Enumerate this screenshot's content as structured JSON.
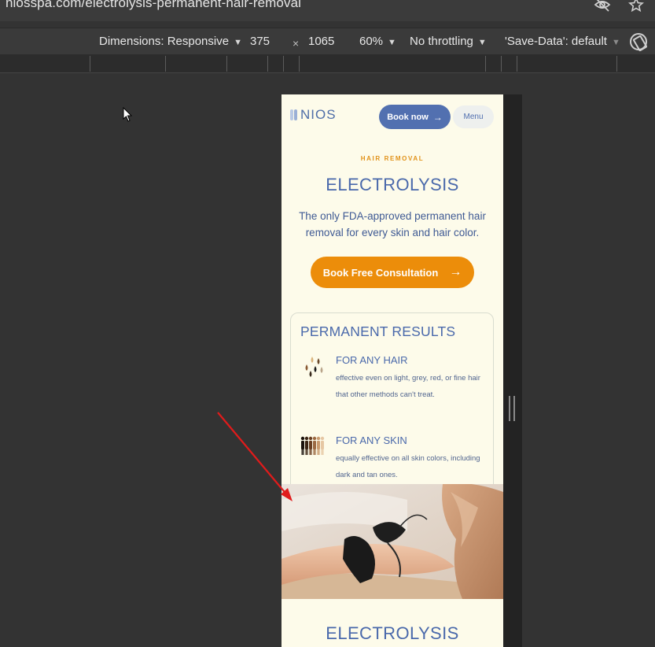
{
  "browser": {
    "url": "niosspa.com/electrolysis-permanent-hair-removal",
    "icons": [
      "eye-slash-icon",
      "star-icon"
    ]
  },
  "devtools": {
    "dimensions_label": "Dimensions: Responsive",
    "width": "375",
    "times": "×",
    "height": "1065",
    "zoom": "60%",
    "throttling": "No throttling",
    "save_data": "'Save-Data': default"
  },
  "site": {
    "logo": "NIOS",
    "book_now": "Book now",
    "menu": "Menu",
    "eyebrow": "HAIR REMOVAL",
    "title": "ELECTROLYSIS",
    "subtitle": "The only FDA-approved permanent hair removal for every skin and hair color.",
    "cta": "Book Free Consultation",
    "arrow": "→",
    "card": {
      "title": "PERMANENT RESULTS",
      "features": [
        {
          "title": "FOR ANY HAIR",
          "desc": "effective even on light, grey, red, or fine hair that other methods can't treat."
        },
        {
          "title": "FOR ANY SKIN",
          "desc": "equally effective on all skin colors, including dark and tan ones."
        }
      ]
    },
    "section_title": "ELECTROLYSIS"
  },
  "colors": {
    "brand_blue": "#4a69ab",
    "accent_orange": "#ec8d0a",
    "page_cream": "#fdfbea",
    "annotation_red": "#e01b1b"
  }
}
